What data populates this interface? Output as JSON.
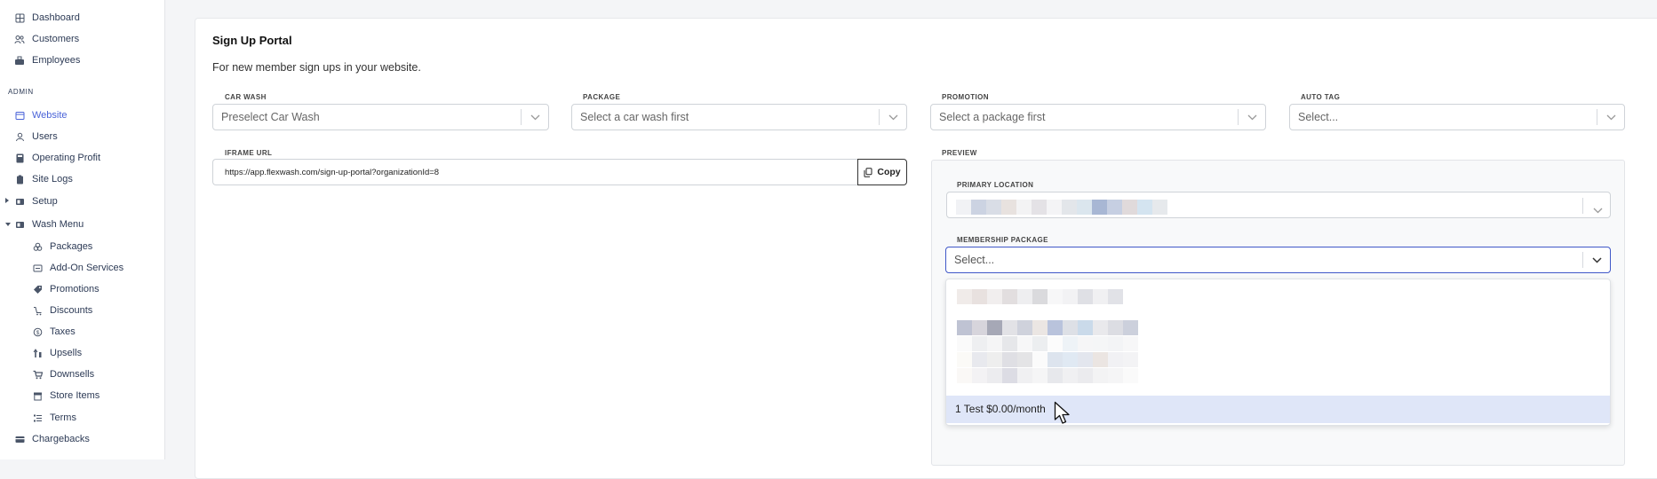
{
  "sidebar": {
    "items": [
      {
        "label": "Dashboard",
        "icon": "grid-icon"
      },
      {
        "label": "Customers",
        "icon": "users-icon"
      },
      {
        "label": "Employees",
        "icon": "employee-icon"
      }
    ],
    "admin_heading": "ADMIN",
    "admin_items": [
      {
        "label": "Website",
        "icon": "browser-icon",
        "active": true
      },
      {
        "label": "Users",
        "icon": "user-icon"
      },
      {
        "label": "Operating Profit",
        "icon": "calculator-icon"
      },
      {
        "label": "Site Logs",
        "icon": "clipboard-icon"
      },
      {
        "label": "Setup",
        "icon": "setup-icon"
      },
      {
        "label": "Wash Menu",
        "icon": "menu-icon"
      }
    ],
    "wash_menu_items": [
      {
        "label": "Packages",
        "icon": "packages-icon"
      },
      {
        "label": "Add-On Services",
        "icon": "addon-icon"
      },
      {
        "label": "Promotions",
        "icon": "tag-icon"
      },
      {
        "label": "Discounts",
        "icon": "discount-icon"
      },
      {
        "label": "Taxes",
        "icon": "tax-icon"
      },
      {
        "label": "Upsells",
        "icon": "upsell-icon"
      },
      {
        "label": "Downsells",
        "icon": "cart-icon"
      },
      {
        "label": "Store Items",
        "icon": "store-icon"
      },
      {
        "label": "Terms",
        "icon": "terms-icon"
      }
    ],
    "bottom_item": {
      "label": "Chargebacks",
      "icon": "card-icon"
    }
  },
  "portal": {
    "title": "Sign Up Portal",
    "subtitle": "For new member sign ups in your website.",
    "car_wash": {
      "label": "CAR WASH",
      "value": "Preselect Car Wash"
    },
    "package": {
      "label": "PACKAGE",
      "value": "Select a car wash first"
    },
    "promotion": {
      "label": "PROMOTION",
      "value": "Select a package first"
    },
    "auto_tag": {
      "label": "AUTO TAG",
      "value": "Select..."
    },
    "iframe": {
      "label": "IFRAME URL",
      "value": "https://app.flexwash.com/sign-up-portal?organizationId=8",
      "copy_label": "Copy"
    }
  },
  "preview": {
    "label": "PREVIEW",
    "primary_location_label": "PRIMARY LOCATION",
    "membership_label": "MEMBERSHIP PACKAGE",
    "membership_placeholder": "Select...",
    "highlighted_option": "1 Test $0.00/month"
  },
  "colors": {
    "accent": "#4a63d8",
    "highlight": "#dfe6f8",
    "focus_border": "#4058c8"
  }
}
